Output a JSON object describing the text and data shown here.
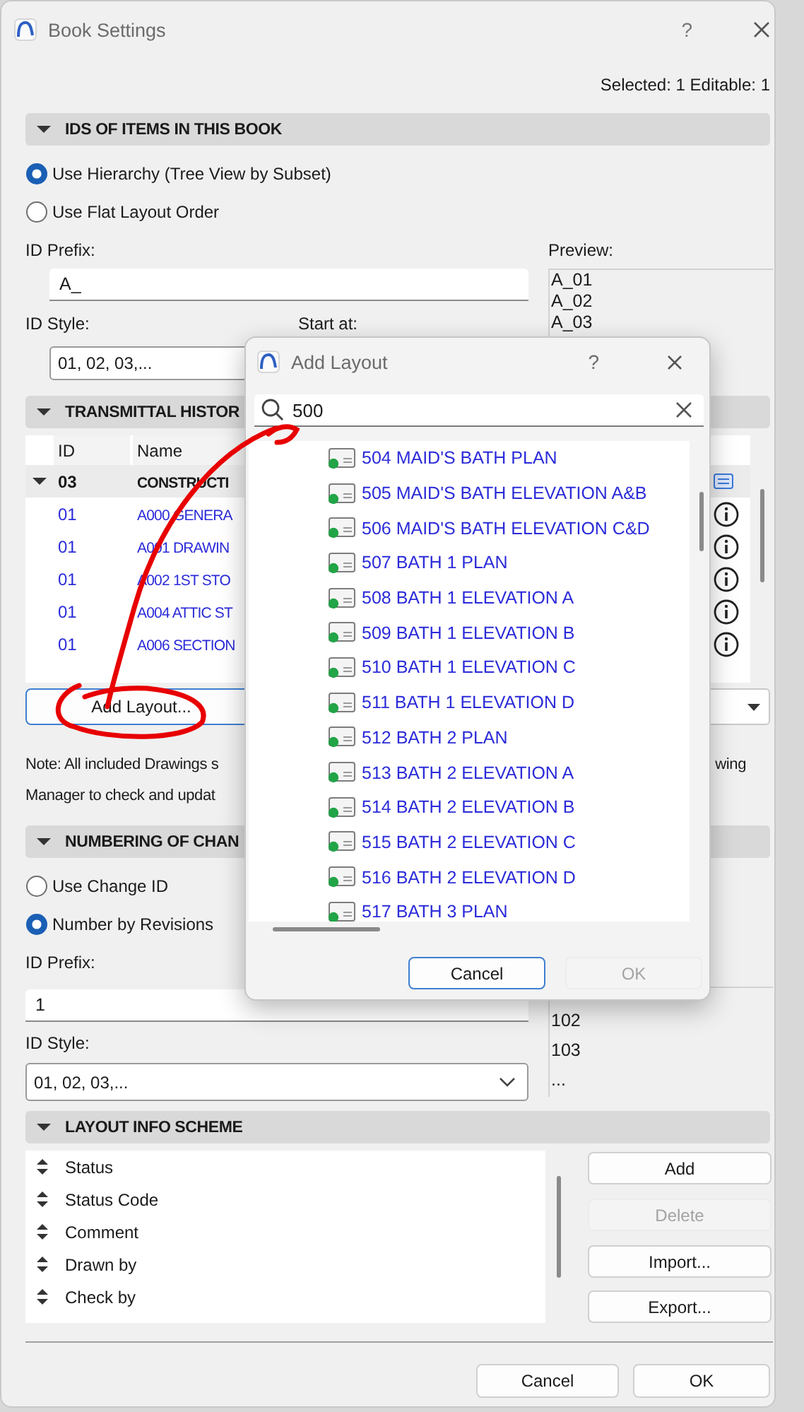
{
  "window": {
    "title": "Book Settings",
    "help": "?"
  },
  "selection_info": "Selected: 1 Editable: 1",
  "ids_section": {
    "title": "IDS OF ITEMS IN THIS BOOK",
    "expanded": true,
    "options": [
      {
        "label": "Use Hierarchy (Tree View by Subset)",
        "selected": true
      },
      {
        "label": "Use Flat Layout Order",
        "selected": false
      }
    ],
    "id_prefix_label": "ID Prefix:",
    "id_prefix": "A_",
    "preview_label": "Preview:",
    "preview": [
      "A_01",
      "A_02",
      "A_03"
    ],
    "id_style_label": "ID Style:",
    "id_style": "01, 02, 03,...",
    "start_at_label": "Start at:"
  },
  "transmittal_section": {
    "title": "TRANSMITTAL HISTOR",
    "expanded": true,
    "columns": [
      "ID",
      "Name"
    ],
    "group": {
      "id": "03",
      "name": "CONSTRUCTI",
      "expanded": true
    },
    "rows": [
      {
        "id": "01",
        "name": "A000 GENERA"
      },
      {
        "id": "01",
        "name": "A001 DRAWIN"
      },
      {
        "id": "01",
        "name": "A002 1ST STO"
      },
      {
        "id": "01",
        "name": "A004 ATTIC ST"
      },
      {
        "id": "01",
        "name": "A006 SECTION"
      }
    ],
    "add_button": "Add Layout...",
    "note_lines": [
      "Note: All included Drawings s",
      "wing",
      "Manager to check and updat"
    ]
  },
  "numbering_section": {
    "title": "NUMBERING OF CHAN",
    "expanded": true,
    "options": [
      {
        "label": "Use Change ID",
        "selected": false
      },
      {
        "label": "Number by Revisions",
        "selected": true
      }
    ],
    "id_prefix_label": "ID Prefix:",
    "id_prefix": "1",
    "id_style_label": "ID Style:",
    "id_style": "01, 02, 03,...",
    "preview": [
      "102",
      "103",
      "..."
    ]
  },
  "layout_info_section": {
    "title": "LAYOUT INFO SCHEME",
    "expanded": true,
    "items": [
      "Status",
      "Status Code",
      "Comment",
      "Drawn by",
      "Check by"
    ],
    "buttons": [
      {
        "label": "Add",
        "disabled": false
      },
      {
        "label": "Delete",
        "disabled": true
      },
      {
        "label": "Import...",
        "disabled": false
      },
      {
        "label": "Export...",
        "disabled": false
      }
    ]
  },
  "footer_buttons": [
    {
      "label": "Cancel",
      "disabled": false
    },
    {
      "label": "OK",
      "disabled": false
    }
  ],
  "add_layout_dialog": {
    "title": "Add Layout",
    "help": "?",
    "search": {
      "value": "500"
    },
    "items": [
      "504 MAID'S BATH PLAN",
      "505 MAID'S BATH ELEVATION A&B",
      "506 MAID'S BATH ELEVATION C&D",
      "507 BATH 1 PLAN",
      "508 BATH 1 ELEVATION A",
      "509 BATH 1 ELEVATION B",
      "510 BATH 1 ELEVATION C",
      "511 BATH 1 ELEVATION D",
      "512 BATH 2 PLAN",
      "513 BATH 2 ELEVATION A",
      "514 BATH 2 ELEVATION B",
      "515 BATH 2 ELEVATION C",
      "516 BATH 2 ELEVATION D",
      "517 BATH 3 PLAN"
    ],
    "buttons": [
      {
        "label": "Cancel",
        "disabled": false,
        "focused": true
      },
      {
        "label": "OK",
        "disabled": true,
        "focused": false
      }
    ]
  }
}
